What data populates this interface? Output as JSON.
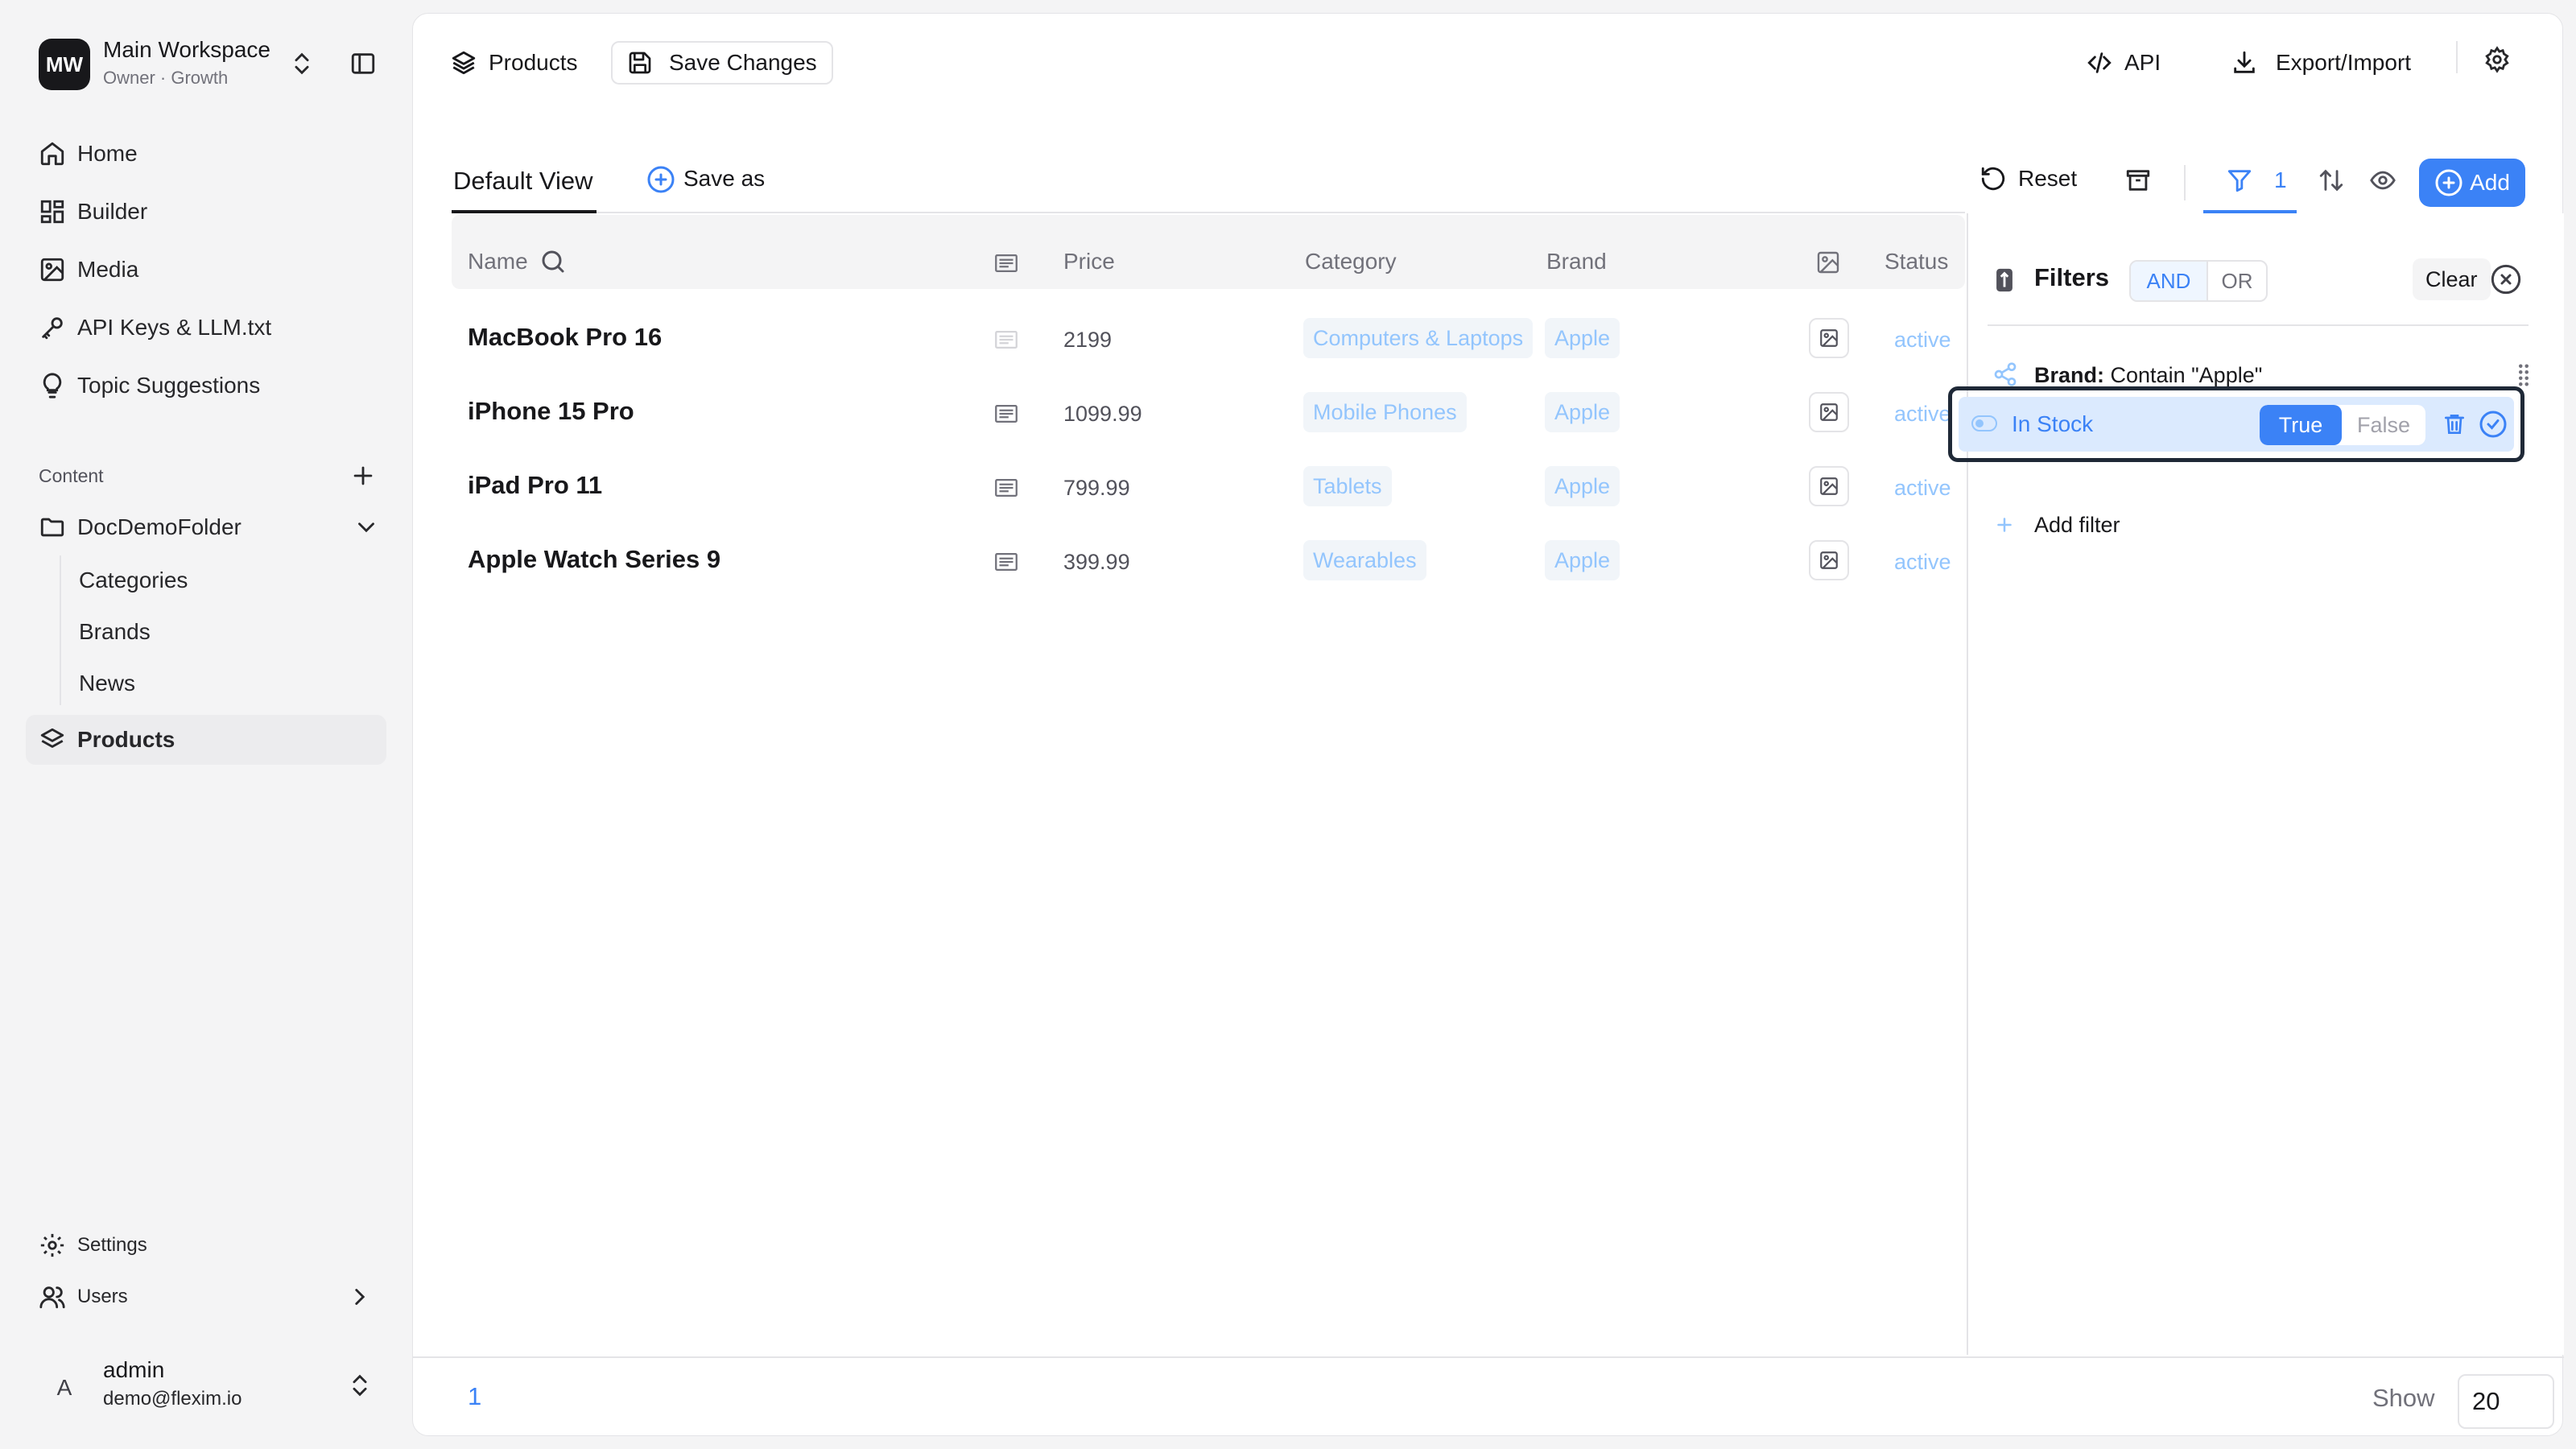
{
  "workspace": {
    "initials": "MW",
    "name": "Main Workspace",
    "subtitle": "Owner · Growth"
  },
  "nav": [
    {
      "label": "Home",
      "icon": "home-icon"
    },
    {
      "label": "Builder",
      "icon": "builder-icon"
    },
    {
      "label": "Media",
      "icon": "media-icon"
    },
    {
      "label": "API Keys & LLM.txt",
      "icon": "key-icon"
    },
    {
      "label": "Topic Suggestions",
      "icon": "lightbulb-icon"
    }
  ],
  "content": {
    "section_label": "Content",
    "folder": "DocDemoFolder",
    "sub_items": [
      "Categories",
      "Brands",
      "News"
    ],
    "active_item": "Products"
  },
  "bottom_nav": {
    "settings": "Settings",
    "users": "Users"
  },
  "user": {
    "initial": "A",
    "name": "admin",
    "email": "demo@flexim.io"
  },
  "topbar": {
    "collection": "Products",
    "save_changes": "Save Changes",
    "api": "API",
    "export_import": "Export/Import"
  },
  "views": {
    "default": "Default View",
    "save_as": "Save as"
  },
  "toolbar": {
    "reset": "Reset",
    "filter_count": "1",
    "add": "Add"
  },
  "table": {
    "columns": [
      "Name",
      "Price",
      "Category",
      "Brand",
      "Status"
    ],
    "rows": [
      {
        "name": "MacBook Pro 16",
        "price": "2199",
        "category": "Computers & Laptops",
        "brand": "Apple",
        "status": "active"
      },
      {
        "name": "iPhone 15 Pro",
        "price": "1099.99",
        "category": "Mobile Phones",
        "brand": "Apple",
        "status": "active"
      },
      {
        "name": "iPad Pro 11",
        "price": "799.99",
        "category": "Tablets",
        "brand": "Apple",
        "status": "active"
      },
      {
        "name": "Apple Watch Series 9",
        "price": "399.99",
        "category": "Wearables",
        "brand": "Apple",
        "status": "active"
      }
    ]
  },
  "filters": {
    "title": "Filters",
    "and": "AND",
    "or": "OR",
    "clear": "Clear",
    "brand_filter_label": "Brand:",
    "brand_filter_value": "Contain \"Apple\"",
    "in_stock": "In Stock",
    "true": "True",
    "false": "False",
    "add_filter": "Add filter"
  },
  "footer": {
    "page": "1",
    "show": "Show",
    "page_size": "20"
  },
  "colors": {
    "accent": "#3b82f6",
    "accent_light": "#dbeafe",
    "tag_text": "#93c5fd"
  }
}
